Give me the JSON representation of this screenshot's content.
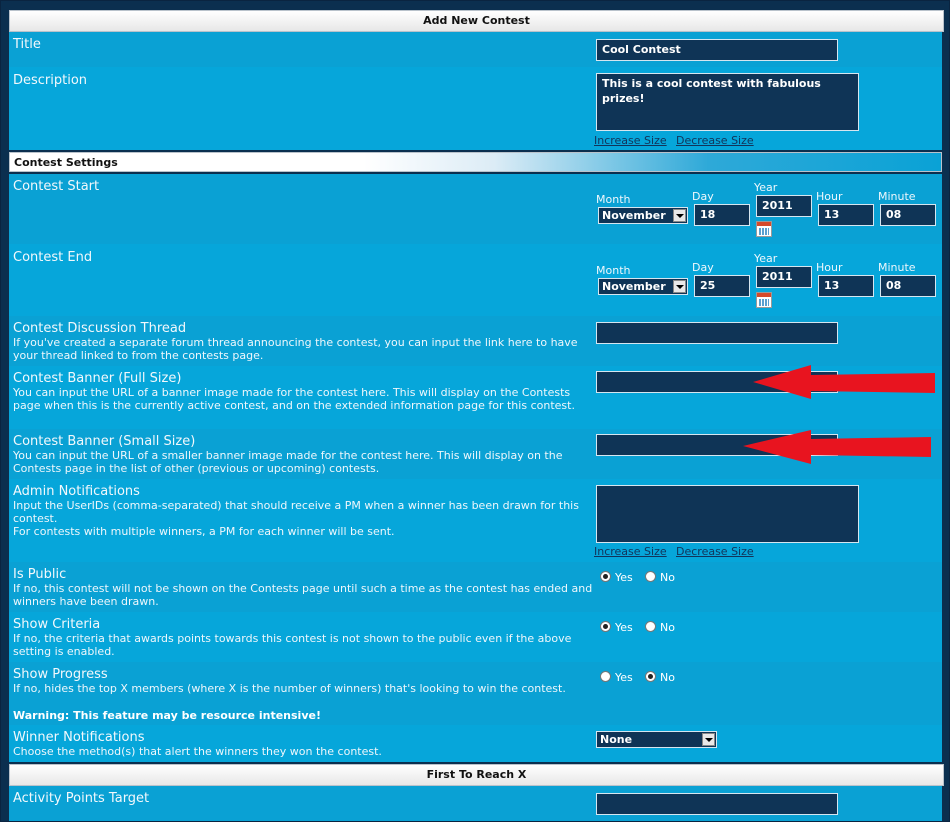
{
  "header": {
    "title": "Add New Contest"
  },
  "title_row": {
    "label": "Title",
    "value": "Cool Contest"
  },
  "description_row": {
    "label": "Description",
    "value": "This is a cool contest with fabulous prizes!",
    "increase": "Increase Size",
    "decrease": "Decrease Size"
  },
  "settings_header": "Contest Settings",
  "date_labels": {
    "month": "Month",
    "day": "Day",
    "year": "Year",
    "hour": "Hour",
    "minute": "Minute"
  },
  "contest_start": {
    "label": "Contest Start",
    "month": "November",
    "day": "18",
    "year": "2011",
    "hour": "13",
    "minute": "08"
  },
  "contest_end": {
    "label": "Contest End",
    "month": "November",
    "day": "25",
    "year": "2011",
    "hour": "13",
    "minute": "08"
  },
  "discussion_thread": {
    "label": "Contest Discussion Thread",
    "desc": "If you've created a separate forum thread announcing the contest, you can input the link here to have your thread linked to from the contests page.",
    "value": ""
  },
  "banner_full": {
    "label": "Contest Banner (Full Size)",
    "desc": "You can input the URL of a banner image made for the contest here. This will display on the Contests page when this is the currently active contest, and on the extended information page for this contest.",
    "value": ""
  },
  "banner_small": {
    "label": "Contest Banner (Small Size)",
    "desc": "You can input the URL of a smaller banner image made for the contest here. This will display on the Contests page in the list of other (previous or upcoming) contests.",
    "value": ""
  },
  "admin_notifications": {
    "label": "Admin Notifications",
    "desc1": "Input the UserIDs (comma-separated) that should receive a PM when a winner has been drawn for this contest.",
    "desc2": "For contests with multiple winners, a PM for each winner will be sent.",
    "value": "",
    "increase": "Increase Size",
    "decrease": "Decrease Size"
  },
  "is_public": {
    "label": "Is Public",
    "desc": "If no, this contest will not be shown on the Contests page until such a time as the contest has ended and winners have been drawn.",
    "yes": "Yes",
    "no": "No",
    "selected": "yes"
  },
  "show_criteria": {
    "label": "Show Criteria",
    "desc": "If no, the criteria that awards points towards this contest is not shown to the public even if the above setting is enabled.",
    "yes": "Yes",
    "no": "No",
    "selected": "yes"
  },
  "show_progress": {
    "label": "Show Progress",
    "desc": "If no, hides the top X members (where X is the number of winners) that's looking to win the contest.",
    "warning": "Warning: This feature may be resource intensive!",
    "yes": "Yes",
    "no": "No",
    "selected": "no"
  },
  "winner_notifications": {
    "label": "Winner Notifications",
    "desc": "Choose the method(s) that alert the winners they won the contest.",
    "value": "None"
  },
  "first_to_reach_header": "First To Reach X",
  "activity_points": {
    "label": "Activity Points Target",
    "value": ""
  },
  "colors": {
    "row": "#0aa1d4",
    "input": "#0f3456",
    "arrow": "#e8141f"
  }
}
